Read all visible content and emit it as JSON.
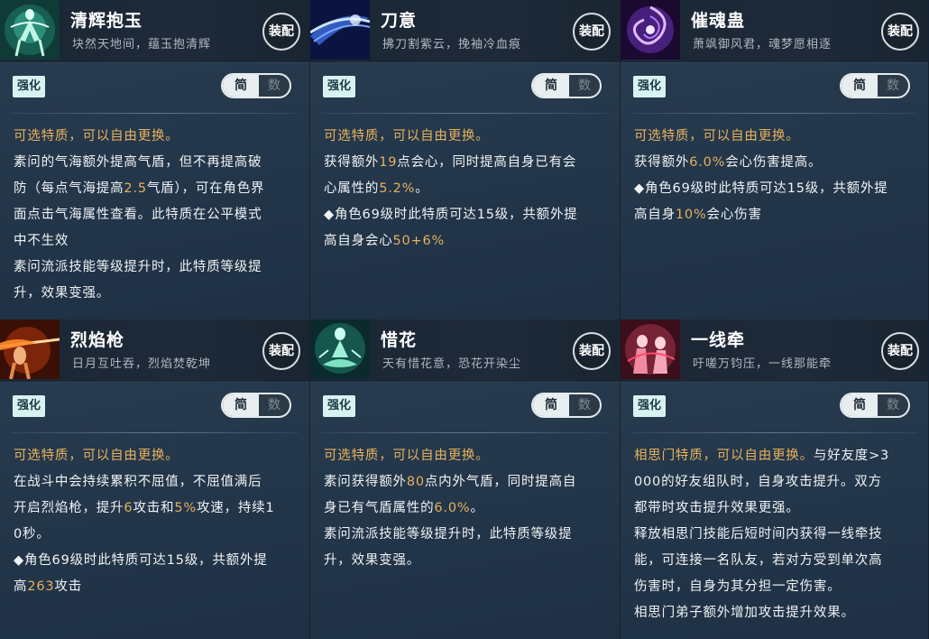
{
  "cards": [
    {
      "name": "清辉抱玉",
      "subtitle": "块然天地间，蕴玉抱清辉",
      "equip_label": "装配",
      "tag": "强化",
      "toggle_on": "简",
      "toggle_off": "数",
      "heading": "可选特质，可以自由更换。",
      "lines": [
        [
          "素问的气海额外提高气盾，但不再提高破"
        ],
        [
          "防（每点气海提高",
          {
            "hl": "2.5"
          },
          "气盾），可在角色界"
        ],
        [
          "面点击气海属性查看。此特质在公平模式"
        ],
        [
          "中不生效"
        ],
        [
          "素问流派技能等级提升时，此特质等级提"
        ],
        [
          "升，效果变强。"
        ]
      ]
    },
    {
      "name": "刀意",
      "subtitle": "拂刀割紫云，挽袖冷血痕",
      "equip_label": "装配",
      "tag": "强化",
      "toggle_on": "简",
      "toggle_off": "数",
      "heading": "可选特质，可以自由更换。",
      "lines": [
        [
          "获得额外",
          {
            "hl": "19"
          },
          "点会心，同时提高自身已有会"
        ],
        [
          "心属性的",
          {
            "hl": "5.2%"
          },
          "。"
        ],
        [
          "◆角色69级时此特质可达15级，共额外提"
        ],
        [
          "高自身会心",
          {
            "hl": "50+6%"
          }
        ]
      ]
    },
    {
      "name": "催魂蛊",
      "subtitle": "萧飒御风君，魂梦愿相逐",
      "equip_label": "装配",
      "tag": "强化",
      "toggle_on": "简",
      "toggle_off": "数",
      "heading": "可选特质，可以自由更换。",
      "lines": [
        [
          "获得额外",
          {
            "hl": "6.0%"
          },
          "会心伤害提高。"
        ],
        [
          "◆角色69级时此特质可达15级，共额外提"
        ],
        [
          "高自身",
          {
            "hl": "10%"
          },
          "会心伤害"
        ]
      ]
    },
    {
      "name": "烈焰枪",
      "subtitle": "日月互吐吞，烈焰焚乾坤",
      "equip_label": "装配",
      "tag": "强化",
      "toggle_on": "简",
      "toggle_off": "数",
      "heading": "可选特质，可以自由更换。",
      "lines": [
        [
          "在战斗中会持续累积不屈值，不屈值满后"
        ],
        [
          "开启烈焰枪，提升",
          {
            "hl": "6"
          },
          "攻击和",
          {
            "hl": "5%"
          },
          "攻速，持续1"
        ],
        [
          "0秒。"
        ],
        [
          "◆角色69级时此特质可达15级，共额外提"
        ],
        [
          "高",
          {
            "hl": "263"
          },
          "攻击"
        ]
      ]
    },
    {
      "name": "惜花",
      "subtitle": "天有惜花意，恐花开染尘",
      "equip_label": "装配",
      "tag": "强化",
      "toggle_on": "简",
      "toggle_off": "数",
      "heading": "可选特质，可以自由更换。",
      "lines": [
        [
          "素问获得额外",
          {
            "hl": "80"
          },
          "点内外气盾，同时提高自"
        ],
        [
          "身已有气盾属性的",
          {
            "hl": "6.0%"
          },
          "。"
        ],
        [
          "素问流派技能等级提升时，此特质等级提"
        ],
        [
          "升，效果变强。"
        ]
      ]
    },
    {
      "name": "一线牵",
      "subtitle": "吁嗟万钧压，一线那能牵",
      "equip_label": "装配",
      "tag": "强化",
      "toggle_on": "简",
      "toggle_off": "数",
      "heading": "相思门特质，可以自由更换。",
      "heading_tail": "与好友度>3",
      "lines": [
        [
          "000的好友组队时，自身攻击提升。双方"
        ],
        [
          "都带时攻击提升效果更强。"
        ],
        [
          "释放相思门技能后短时间内获得一线牵技"
        ],
        [
          "能，可连接一名队友，若对方受到单次高"
        ],
        [
          "伤害时，自身为其分担一定伤害。"
        ],
        [
          "相思门弟子额外增加攻击提升效果。"
        ]
      ]
    }
  ],
  "colors": {
    "highlight": "#e4b15e",
    "heading": "#e8b25c",
    "text": "#f0f3f5"
  },
  "icons": [
    "green-monk-icon",
    "blade-wave-icon",
    "purple-vortex-icon",
    "flame-spear-icon",
    "meditation-icon",
    "red-thread-icon"
  ]
}
